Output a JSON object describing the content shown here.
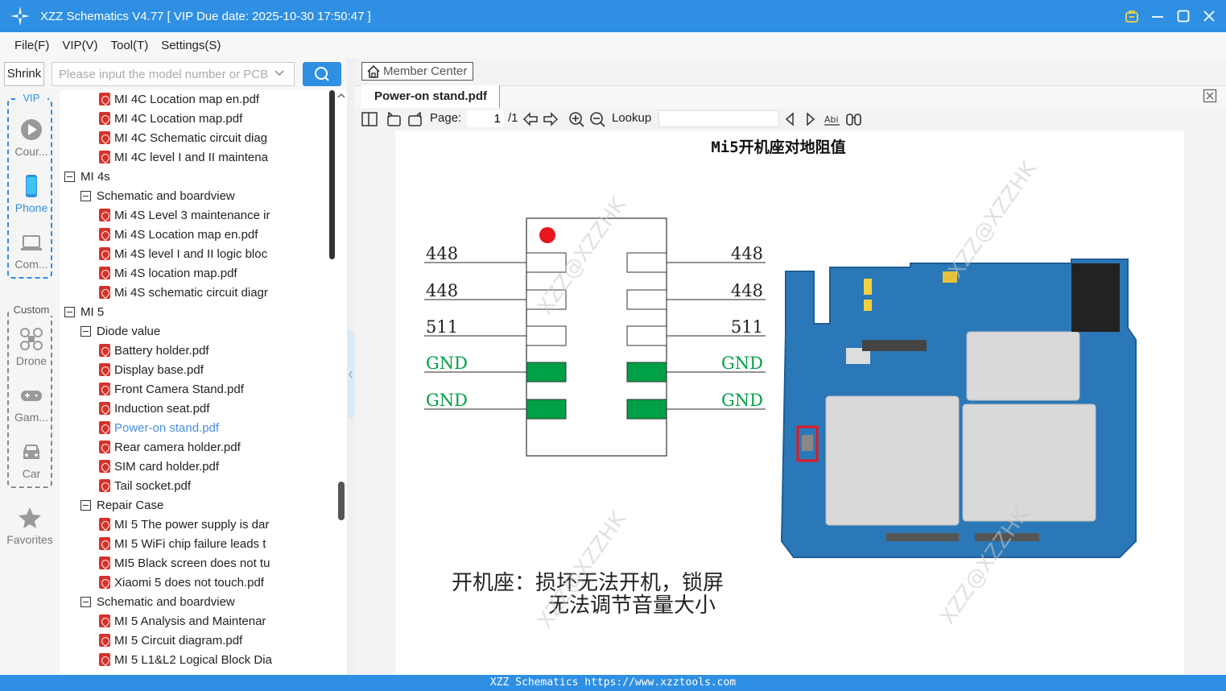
{
  "window": {
    "title": "XZZ Schematics V4.77 [ VIP Due date: 2025-10-30 17:50:47 ]"
  },
  "menu": [
    "File(F)",
    "VIP(V)",
    "Tool(T)",
    "Settings(S)"
  ],
  "search": {
    "shrink_label": "Shrink",
    "placeholder": "Please input the model number or PCB"
  },
  "rail": {
    "vip_label": "VIP",
    "custom_label": "Custom",
    "items": [
      "Cour...",
      "Phone",
      "Com...",
      "Drone",
      "Gam...",
      "Car",
      "Favorites"
    ]
  },
  "tree": [
    {
      "level": 2,
      "type": "pdf",
      "label": "MI 4C Location map en.pdf"
    },
    {
      "level": 2,
      "type": "pdf",
      "label": "MI 4C Location map.pdf"
    },
    {
      "level": 2,
      "type": "pdf",
      "label": "MI 4C Schematic circuit diag"
    },
    {
      "level": 2,
      "type": "pdf",
      "label": "MI 4C level I and II maintena"
    },
    {
      "level": 0,
      "type": "folder",
      "label": "MI 4s"
    },
    {
      "level": 1,
      "type": "folder",
      "label": "Schematic and boardview"
    },
    {
      "level": 2,
      "type": "pdf",
      "label": "Mi 4S Level 3 maintenance ir"
    },
    {
      "level": 2,
      "type": "pdf",
      "label": "Mi 4S Location map en.pdf"
    },
    {
      "level": 2,
      "type": "pdf",
      "label": "Mi 4S level I and II logic bloc"
    },
    {
      "level": 2,
      "type": "pdf",
      "label": "Mi 4S location map.pdf"
    },
    {
      "level": 2,
      "type": "pdf",
      "label": "Mi 4S schematic circuit diagr"
    },
    {
      "level": 0,
      "type": "folder",
      "label": "MI 5"
    },
    {
      "level": 1,
      "type": "folder",
      "label": "Diode value"
    },
    {
      "level": 2,
      "type": "pdf",
      "label": "Battery holder.pdf"
    },
    {
      "level": 2,
      "type": "pdf",
      "label": "Display base.pdf"
    },
    {
      "level": 2,
      "type": "pdf",
      "label": "Front Camera Stand.pdf"
    },
    {
      "level": 2,
      "type": "pdf",
      "label": "Induction seat.pdf"
    },
    {
      "level": 2,
      "type": "pdf",
      "label": "Power-on stand.pdf",
      "selected": true
    },
    {
      "level": 2,
      "type": "pdf",
      "label": "Rear camera holder.pdf"
    },
    {
      "level": 2,
      "type": "pdf",
      "label": "SIM card holder.pdf"
    },
    {
      "level": 2,
      "type": "pdf",
      "label": "Tail socket.pdf"
    },
    {
      "level": 1,
      "type": "folder",
      "label": "Repair Case"
    },
    {
      "level": 2,
      "type": "pdf",
      "label": "MI 5 The power supply is dar"
    },
    {
      "level": 2,
      "type": "pdf",
      "label": "MI 5 WiFi chip failure leads t"
    },
    {
      "level": 2,
      "type": "pdf",
      "label": "MI5 Black screen does not tu"
    },
    {
      "level": 2,
      "type": "pdf",
      "label": "Xiaomi 5 does not touch.pdf"
    },
    {
      "level": 1,
      "type": "folder",
      "label": "Schematic and boardview"
    },
    {
      "level": 2,
      "type": "pdf",
      "label": "MI 5 Analysis and Maintenar"
    },
    {
      "level": 2,
      "type": "pdf",
      "label": "MI 5 Circuit diagram.pdf"
    },
    {
      "level": 2,
      "type": "pdf",
      "label": "MI 5 L1&L2 Logical Block Dia"
    }
  ],
  "viewer": {
    "member_center": "Member Center",
    "tab_title": "Power-on stand.pdf",
    "page_label": "Page:",
    "page_current": "1",
    "page_total": "/1",
    "lookup_label": "Lookup"
  },
  "document": {
    "heading": "Mi5开机座对地阻值",
    "left_values": [
      "448",
      "448",
      "511",
      "GND",
      "GND"
    ],
    "right_values": [
      "448",
      "448",
      "511",
      "GND",
      "GND"
    ],
    "caption_line1": "开机座：损坏无法开机，锁屏",
    "caption_line2": "无法调节音量大小",
    "watermark": "XZZ@XZZHK",
    "colors": {
      "gnd_fill": "#00a046",
      "gnd_text": "#00a046",
      "dot": "#e8171d",
      "pcb": "#2a78b8"
    }
  },
  "status": {
    "text": "XZZ Schematics https://www.xzztools.com"
  },
  "colors": {
    "accent": "#2e8fe3",
    "selected_text": "#4a8de0",
    "pdf_icon": "#d6322b"
  }
}
